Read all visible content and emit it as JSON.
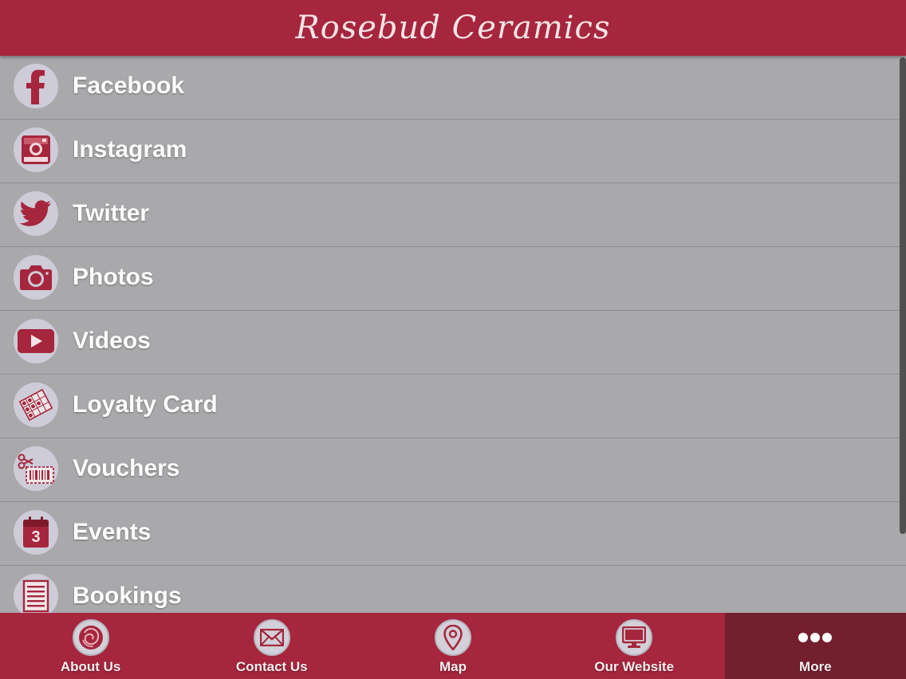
{
  "header": {
    "title": "Rosebud Ceramics"
  },
  "colors": {
    "brand": "#a6263d",
    "brand_dark": "#741f2e",
    "list_bg": "#a9a8ab",
    "icon_bg": "#cdccd8"
  },
  "menu": {
    "items": [
      {
        "label": "Facebook",
        "icon": "facebook-icon"
      },
      {
        "label": "Instagram",
        "icon": "instagram-icon"
      },
      {
        "label": "Twitter",
        "icon": "twitter-icon"
      },
      {
        "label": "Photos",
        "icon": "camera-icon"
      },
      {
        "label": "Videos",
        "icon": "video-play-icon"
      },
      {
        "label": "Loyalty Card",
        "icon": "loyalty-card-icon"
      },
      {
        "label": "Vouchers",
        "icon": "voucher-scissors-icon"
      },
      {
        "label": "Events",
        "icon": "calendar-icon"
      },
      {
        "label": "Bookings",
        "icon": "booking-list-icon"
      }
    ],
    "events_day": "3"
  },
  "tabbar": {
    "items": [
      {
        "label": "About Us",
        "icon": "rose-icon"
      },
      {
        "label": "Contact Us",
        "icon": "envelope-icon"
      },
      {
        "label": "Map",
        "icon": "map-pin-icon"
      },
      {
        "label": "Our Website",
        "icon": "monitor-icon"
      },
      {
        "label": "More",
        "icon": "more-dots-icon",
        "active": true
      }
    ]
  }
}
